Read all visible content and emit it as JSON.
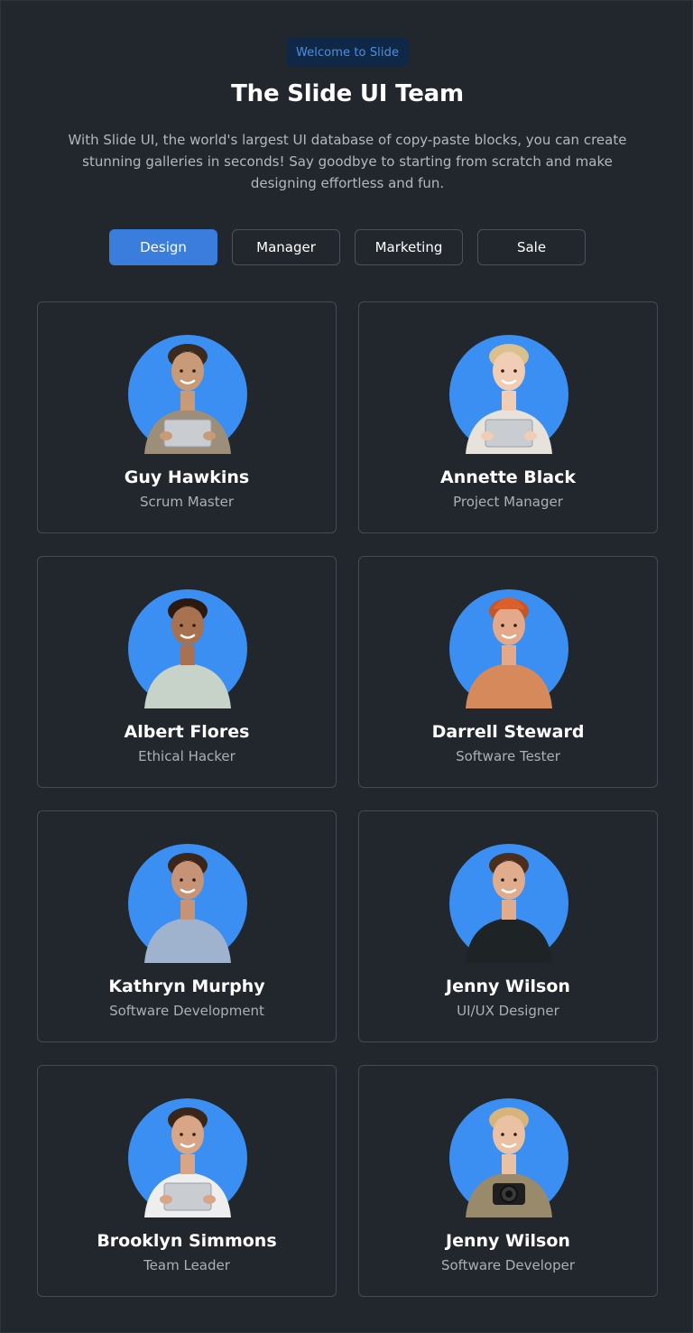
{
  "header": {
    "badge": "Welcome to Slide",
    "title": "The Slide UI Team",
    "description": "With Slide UI, the world's largest UI database of copy-paste blocks, you can create stunning galleries in seconds! Say goodbye to starting from scratch and make designing effortless and fun."
  },
  "tabs": [
    {
      "label": "Design",
      "active": true
    },
    {
      "label": "Manager",
      "active": false
    },
    {
      "label": "Marketing",
      "active": false
    },
    {
      "label": "Sale",
      "active": false
    }
  ],
  "team": [
    {
      "name": "Guy Hawkins",
      "role": "Scrum Master",
      "skin": "#c99a78",
      "hair": "#3a2a1f",
      "top": "#9c8e79",
      "prop": "laptop"
    },
    {
      "name": "Annette Black",
      "role": "Project Manager",
      "skin": "#f0cdb4",
      "hair": "#d9c08c",
      "top": "#e8e2dc",
      "prop": "laptop"
    },
    {
      "name": "Albert Flores",
      "role": "Ethical Hacker",
      "skin": "#a8714f",
      "hair": "#2b1a12",
      "top": "#c7d2c8",
      "prop": "none"
    },
    {
      "name": "Darrell Steward",
      "role": "Software Tester",
      "skin": "#e3a98a",
      "hair": "#c4562b",
      "top": "#d68a5c",
      "prop": "hat"
    },
    {
      "name": "Kathryn Murphy",
      "role": "Software Development",
      "skin": "#c79377",
      "hair": "#3b261b",
      "top": "#9fb3cf",
      "prop": "none"
    },
    {
      "name": "Jenny Wilson",
      "role": "UI/UX Designer",
      "skin": "#e0ac8c",
      "hair": "#4a2f1e",
      "top": "#1e2326",
      "prop": "none"
    },
    {
      "name": "Brooklyn Simmons",
      "role": "Team Leader",
      "skin": "#d8a586",
      "hair": "#3a2618",
      "top": "#eeeeee",
      "prop": "laptop"
    },
    {
      "name": "Jenny Wilson",
      "role": "Software Developer",
      "skin": "#ebc1a3",
      "hair": "#d6b47a",
      "top": "#9a8a6c",
      "prop": "camera"
    }
  ],
  "colors": {
    "background": "#22272e",
    "accent": "#3b7ddd",
    "avatar_circle": "#3b8ef2",
    "badge_bg": "#0f2847",
    "badge_text": "#4a90e2"
  }
}
